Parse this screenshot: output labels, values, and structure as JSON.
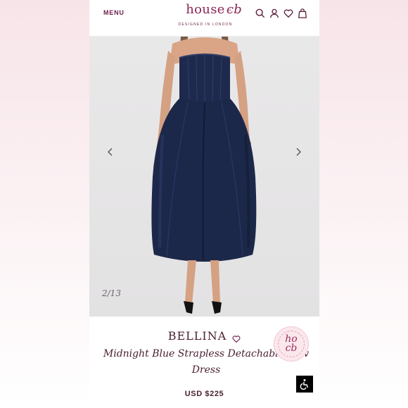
{
  "header": {
    "menu_label": "MENU",
    "logo_text": "house of cb",
    "logo_tagline": "DESIGNED IN LONDON",
    "icons": [
      "search-icon",
      "account-icon",
      "wishlist-heart-icon",
      "bag-icon"
    ]
  },
  "gallery": {
    "counter": "2/13",
    "prev_icon": "chevron-left-icon",
    "next_icon": "chevron-right-icon"
  },
  "product": {
    "name": "BELLINA",
    "description": "Midnight Blue Strapless Detachable Bow Dress",
    "price": "USD $225"
  },
  "badge": {
    "text": "ho cb"
  },
  "colors": {
    "brand": "#8b2656",
    "text": "#4a2033",
    "dress": "#1d2a4d",
    "background": "#f7e4e8"
  }
}
